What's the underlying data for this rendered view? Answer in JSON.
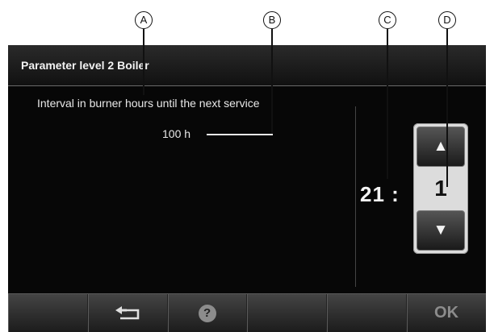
{
  "callouts": [
    "A",
    "B",
    "C",
    "D"
  ],
  "screen": {
    "title": "Parameter level 2 Boiler",
    "description": "Interval in burner hours until the next service",
    "value": "100 h",
    "param_number": "21 :",
    "stepper": {
      "value": "1",
      "up_glyph": "▲",
      "down_glyph": "▼",
      "up_icon": "arrow-up-icon",
      "down_icon": "arrow-down-icon"
    }
  },
  "bottom_bar": {
    "back_icon": "back-arrow-icon",
    "help_glyph": "?",
    "help_icon": "help-icon",
    "ok_label": "OK"
  },
  "colors": {
    "screen_bg": "#070707",
    "text": "#e8e8e8",
    "stepper_bg": "#dcdcdc",
    "disabled_text": "#8c8c8c"
  }
}
